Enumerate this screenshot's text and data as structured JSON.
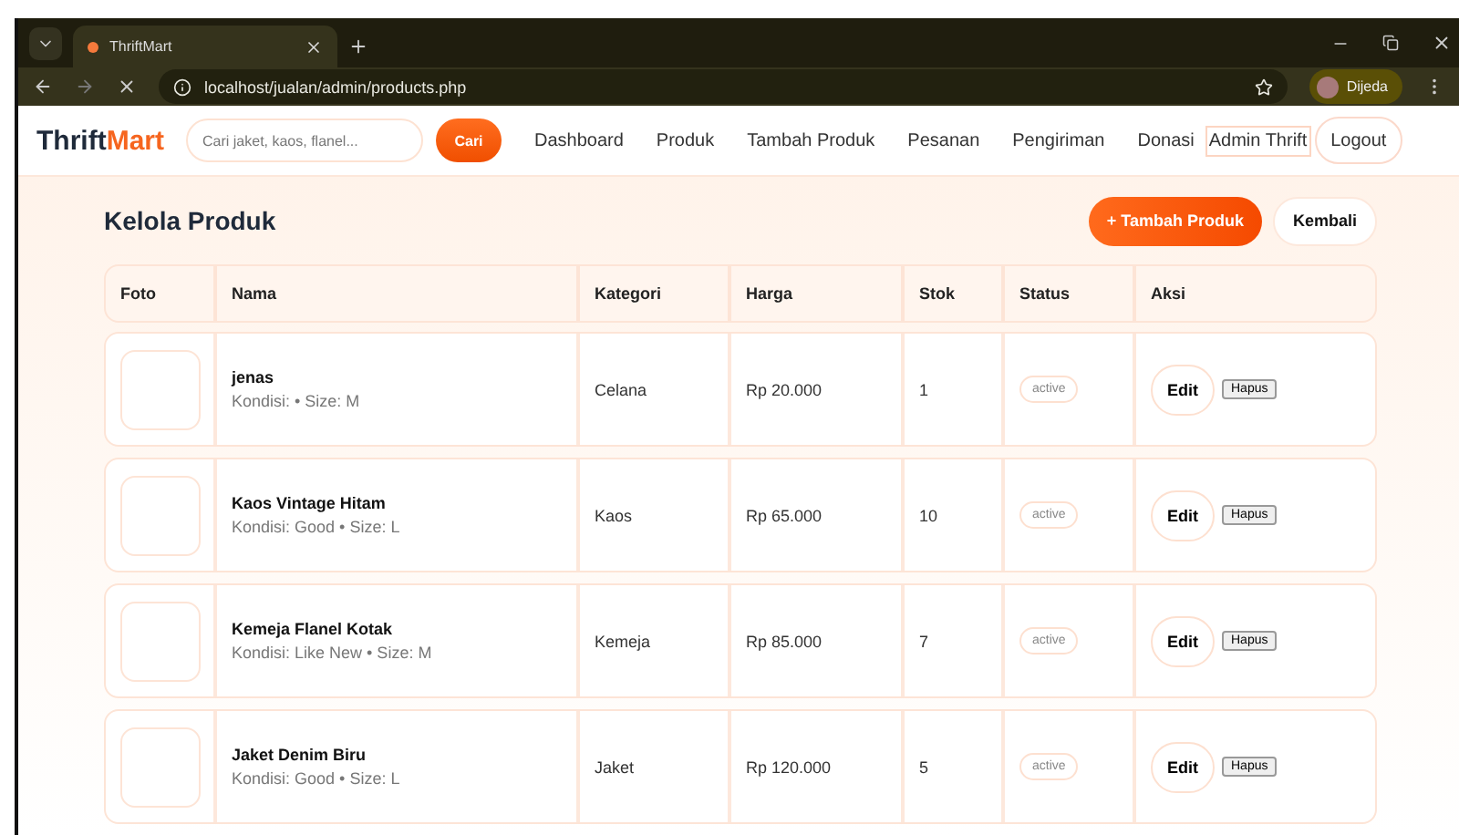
{
  "browser": {
    "tab_title": "ThriftMart",
    "url": "localhost/jualan/admin/products.php",
    "profile": "Dijeda"
  },
  "navbar": {
    "brand": [
      "Thrift",
      "Mart"
    ],
    "search_placeholder": "Cari jaket, kaos, flanel...",
    "search_button": "Cari",
    "links": [
      "Dashboard",
      "Produk",
      "Tambah Produk",
      "Pesanan",
      "Pengiriman",
      "Donasi"
    ],
    "user": "Admin Thrift",
    "logout": "Logout"
  },
  "page": {
    "title": "Kelola Produk",
    "add_button": "+ Tambah Produk",
    "back_button": "Kembali"
  },
  "table": {
    "columns": [
      "Foto",
      "Nama",
      "Kategori",
      "Harga",
      "Stok",
      "Status",
      "Aksi"
    ],
    "rows": [
      {
        "name": "jenas",
        "details": "Kondisi: • Size: M",
        "category": "Celana",
        "price": "Rp 20.000",
        "stock": "1",
        "status": "active",
        "actions": [
          "Edit",
          "Hapus"
        ]
      },
      {
        "name": "Kaos Vintage Hitam",
        "details": "Kondisi: Good • Size: L",
        "category": "Kaos",
        "price": "Rp 65.000",
        "stock": "10",
        "status": "active",
        "actions": [
          "Edit",
          "Hapus"
        ]
      },
      {
        "name": "Kemeja Flanel Kotak",
        "details": "Kondisi: Like New • Size: M",
        "category": "Kemeja",
        "price": "Rp 85.000",
        "stock": "7",
        "status": "active",
        "actions": [
          "Edit",
          "Hapus"
        ]
      },
      {
        "name": "Jaket Denim Biru",
        "details": "Kondisi: Good • Size: L",
        "category": "Jaket",
        "price": "Rp 120.000",
        "stock": "5",
        "status": "active",
        "actions": [
          "Edit",
          "Hapus"
        ]
      }
    ]
  }
}
